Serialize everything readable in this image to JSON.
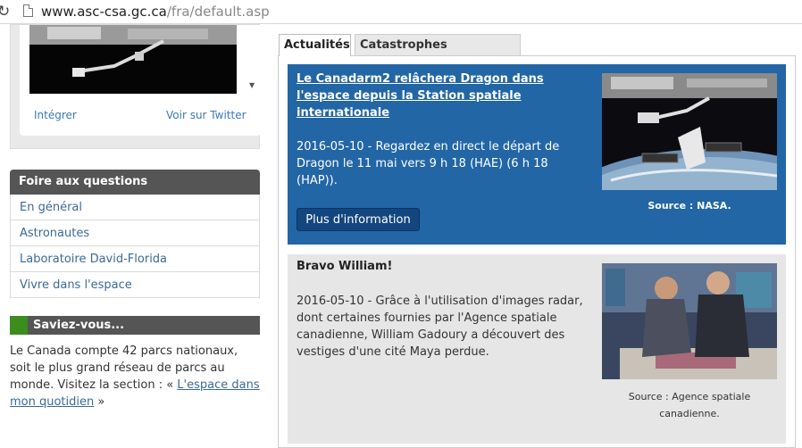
{
  "browser": {
    "url_host": "www.asc-csa.gc.ca",
    "url_path": "/fra/default.asp"
  },
  "twitter": {
    "embed_label": "Intégrer",
    "view_label": "Voir sur Twitter"
  },
  "faq": {
    "title": "Foire aux questions",
    "items": [
      {
        "label": "En général"
      },
      {
        "label": "Astronautes"
      },
      {
        "label": "Laboratoire David-Florida"
      },
      {
        "label": "Vivre dans l'espace"
      }
    ]
  },
  "saviez": {
    "title": "Saviez-vous...",
    "text": "Le Canada compte 42 parcs nationaux, soit le plus grand réseau de parcs au monde. Visitez la section : «",
    "link": "L'espace dans mon quotidien",
    "suffix": " »"
  },
  "tabs": [
    {
      "label": "Actualités",
      "active": true
    },
    {
      "label": "Catastrophes naturelles",
      "active": false
    }
  ],
  "news": [
    {
      "title": "Le Canadarm2 relâchera Dragon dans l'espace depuis la Station spatiale internationale",
      "text": "2016-05-10 - Regardez en direct le départ de Dragon le 11 mai vers 9 h 18 (HAE) (6 h 18 (HAP)).",
      "button": "Plus d'information",
      "caption": "Source : NASA."
    },
    {
      "title": "Bravo William!",
      "text": "2016-05-10 - Grâce à l'utilisation d'images radar, dont certaines fournies par l'Agence spatiale canadienne, William Gadoury a découvert des vestiges d'une cité Maya perdue.",
      "caption": "Source : Agence spatiale canadienne."
    }
  ],
  "colors": {
    "news_blue": "#2266a6",
    "button_blue": "#13467e",
    "saviez_green": "#3c8c1e",
    "header_gray": "#555555",
    "link_blue": "#3a6a96"
  }
}
